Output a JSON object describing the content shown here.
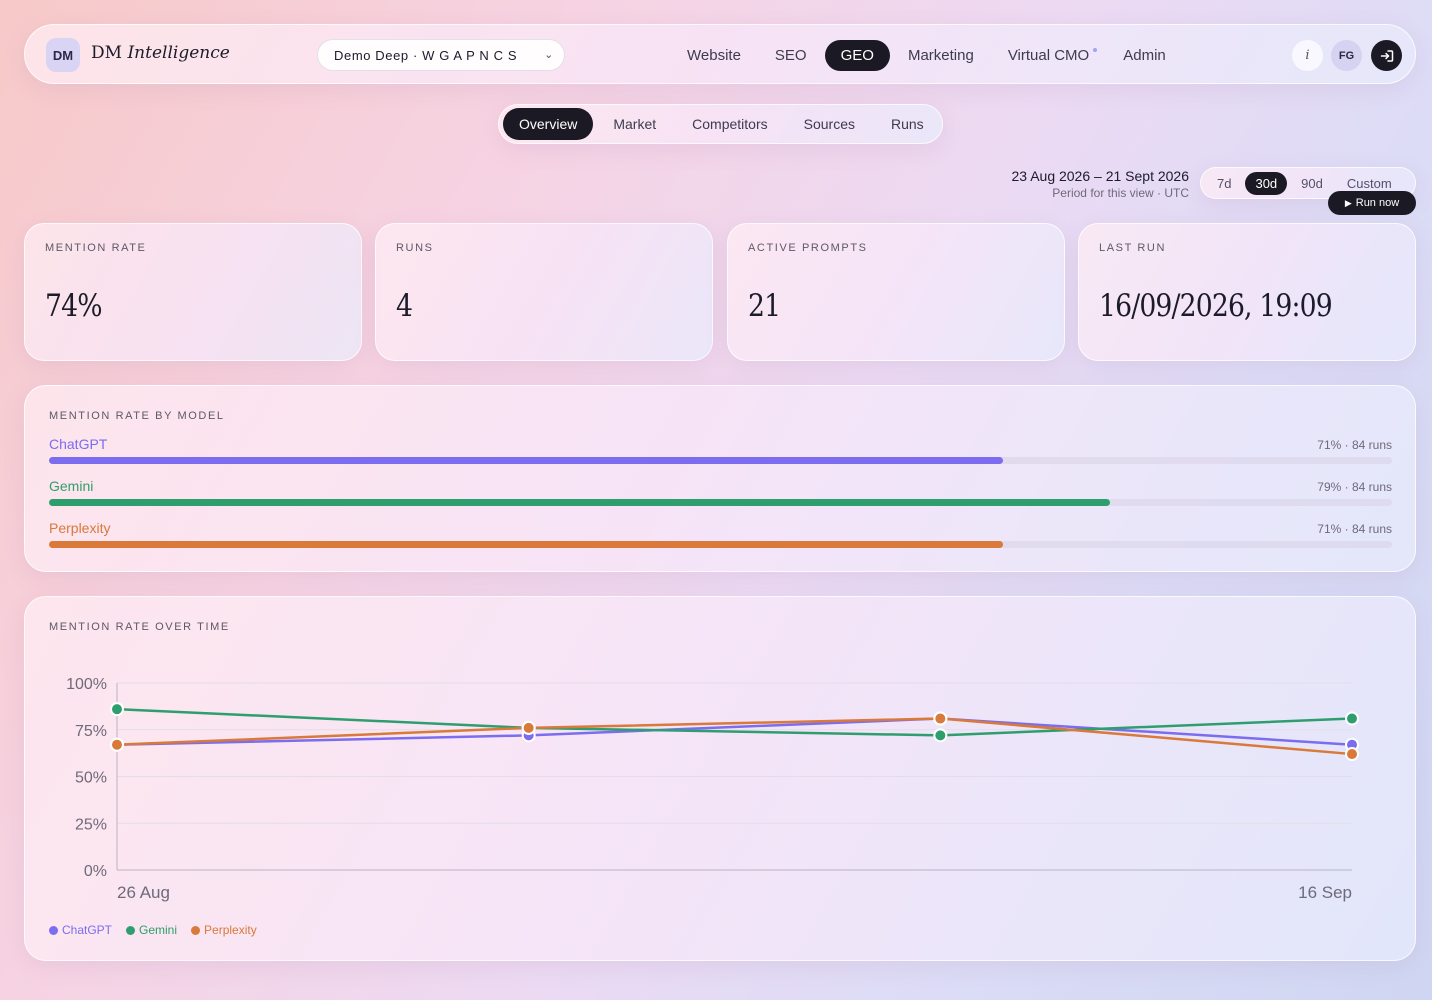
{
  "brand": {
    "badge": "DM",
    "name_plain": "DM",
    "name_italic": "Intelligence"
  },
  "project_select": {
    "value": "Demo Deep · W G A P N C S"
  },
  "nav": [
    {
      "label": "Website",
      "active": false
    },
    {
      "label": "SEO",
      "active": false
    },
    {
      "label": "GEO",
      "active": true
    },
    {
      "label": "Marketing",
      "active": false
    },
    {
      "label": "Virtual CMO",
      "active": false
    },
    {
      "label": "Admin",
      "active": false
    }
  ],
  "header_actions": {
    "info": "i",
    "avatar": "FG",
    "logout_icon": "logout-icon"
  },
  "subtabs": [
    {
      "label": "Overview",
      "active": true
    },
    {
      "label": "Market",
      "active": false
    },
    {
      "label": "Competitors",
      "active": false
    },
    {
      "label": "Sources",
      "active": false
    },
    {
      "label": "Runs",
      "active": false
    }
  ],
  "period": {
    "range": "23 Aug 2026 – 21 Sept 2026",
    "subtitle": "Period for this view · UTC"
  },
  "range_buttons": [
    {
      "label": "7d",
      "active": false
    },
    {
      "label": "30d",
      "active": true
    },
    {
      "label": "90d",
      "active": false
    },
    {
      "label": "Custom",
      "active": false
    }
  ],
  "run_now": {
    "label": "Run now"
  },
  "kpis": [
    {
      "label": "MENTION RATE",
      "value": "74%"
    },
    {
      "label": "RUNS",
      "value": "4"
    },
    {
      "label": "ACTIVE PROMPTS",
      "value": "21"
    },
    {
      "label": "LAST RUN",
      "value": "16/09/2026, 19:09"
    }
  ],
  "models_panel": {
    "title": "MENTION RATE BY MODEL",
    "models": [
      {
        "name": "ChatGPT",
        "meta": "71% · 84 runs",
        "rate": 0.71,
        "color": "#7b6cf0"
      },
      {
        "name": "Gemini",
        "meta": "79% · 84 runs",
        "rate": 0.79,
        "color": "#2f9e6e"
      },
      {
        "name": "Perplexity",
        "meta": "71% · 84 runs",
        "rate": 0.71,
        "color": "#d9793a"
      }
    ]
  },
  "chart_panel": {
    "title": "MENTION RATE OVER TIME"
  },
  "chart_data": {
    "type": "line",
    "x_tick_labels": [
      "26 Aug",
      "16 Sep"
    ],
    "y_ticks": [
      "100%",
      "75%",
      "50%",
      "25%",
      "0%"
    ],
    "ylim": [
      0,
      100
    ],
    "series": [
      {
        "name": "ChatGPT",
        "color": "#7b6cf0",
        "values": [
          67,
          72,
          81,
          67
        ]
      },
      {
        "name": "Gemini",
        "color": "#2f9e6e",
        "values": [
          86,
          76,
          72,
          81
        ]
      },
      {
        "name": "Perplexity",
        "color": "#d9793a",
        "values": [
          67,
          76,
          81,
          62
        ]
      }
    ]
  }
}
